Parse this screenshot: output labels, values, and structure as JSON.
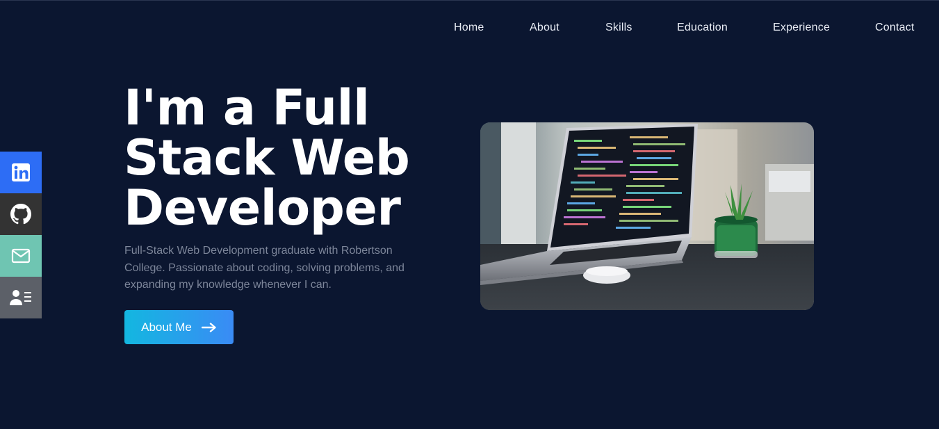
{
  "nav": {
    "items": [
      {
        "label": "Home"
      },
      {
        "label": "About"
      },
      {
        "label": "Skills"
      },
      {
        "label": "Education"
      },
      {
        "label": "Experience"
      },
      {
        "label": "Contact"
      }
    ]
  },
  "social": [
    {
      "icon": "linkedin-icon",
      "color": "#2d6df5"
    },
    {
      "icon": "github-icon",
      "color": "#333333"
    },
    {
      "icon": "mail-icon",
      "color": "#6fc5b2"
    },
    {
      "icon": "contact-card-icon",
      "color": "#5c6068"
    }
  ],
  "hero": {
    "title": "I'm a Full Stack Web Developer",
    "description": "Full-Stack Web Development graduate with Robertson College. Passionate about coding, solving problems, and expanding my knowledge whenever I can.",
    "cta_label": "About Me",
    "cta_icon": "arrow-right-icon",
    "image_icon": "laptop-photo"
  },
  "colors": {
    "background": "#0b1630",
    "accent_start": "#13b7e0",
    "accent_end": "#3a8bf5"
  }
}
